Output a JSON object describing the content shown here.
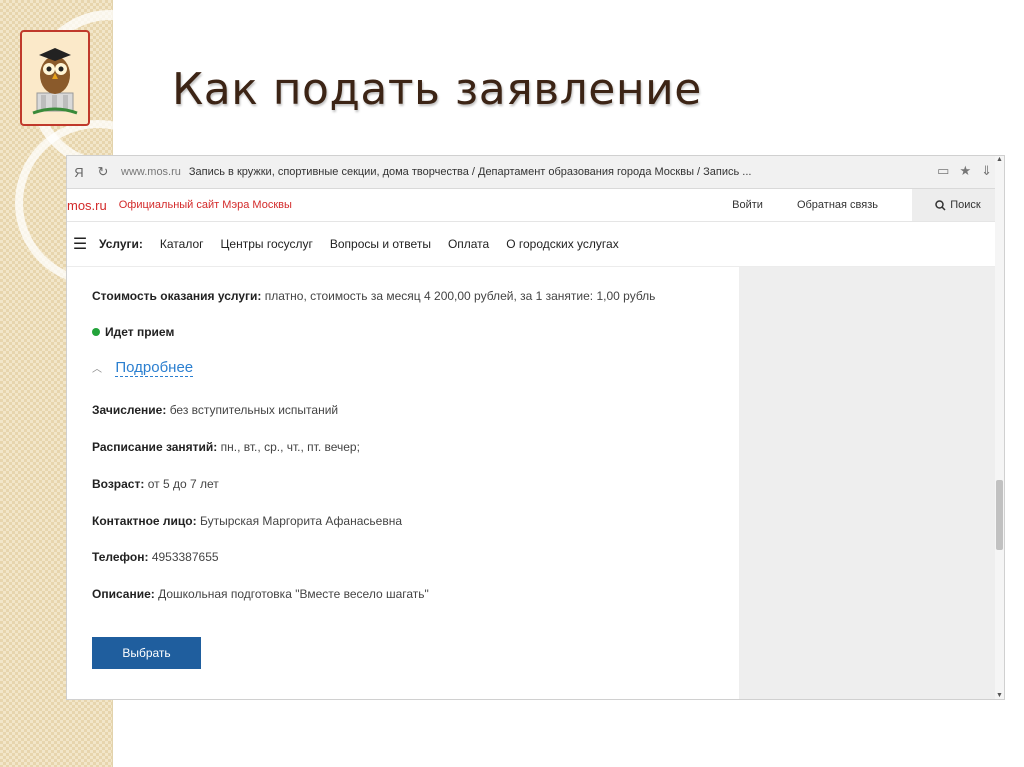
{
  "slide": {
    "title": "Как подать заявление"
  },
  "browser": {
    "domain": "www.mos.ru",
    "page_title": "Запись в кружки, спортивные секции, дома творчества / Департамент образования города Москвы / Запись ..."
  },
  "site": {
    "brand": "mos.ru",
    "brand_sub": "Официальный сайт Мэра Москвы",
    "login": "Войти",
    "feedback": "Обратная связь",
    "search": "Поиск"
  },
  "menu": {
    "items": [
      "Услуги:",
      "Каталог",
      "Центры госуслуг",
      "Вопросы и ответы",
      "Оплата",
      "О городских услугах"
    ]
  },
  "details": {
    "cost_label": "Стоимость оказания услуги:",
    "cost_value": "платно, стоимость за месяц 4 200,00 рублей, за 1 занятие: 1,00 рубль",
    "status": "Идет прием",
    "more": "Подробнее",
    "enroll_label": "Зачисление:",
    "enroll_value": "без вступительных испытаний",
    "schedule_label": "Расписание занятий:",
    "schedule_value": "пн., вт., ср., чт., пт. вечер;",
    "age_label": "Возраст:",
    "age_value": "от 5 до 7 лет",
    "contact_label": "Контактное лицо:",
    "contact_value": "Бутырская Маргорита Афанасьевна",
    "phone_label": "Телефон:",
    "phone_value": "4953387655",
    "desc_label": "Описание:",
    "desc_value": "Дошкольная подготовка \"Вместе весело шагать\"",
    "button": "Выбрать"
  },
  "icons": {
    "logo": "owl-emblem",
    "status": "green-dot-icon",
    "search": "search-icon"
  },
  "colors": {
    "brand_red": "#d32a2a",
    "button_blue": "#1f5e9e",
    "link_blue": "#2b7fd0",
    "status_green": "#22a33a",
    "title_brown": "#3c2415"
  }
}
